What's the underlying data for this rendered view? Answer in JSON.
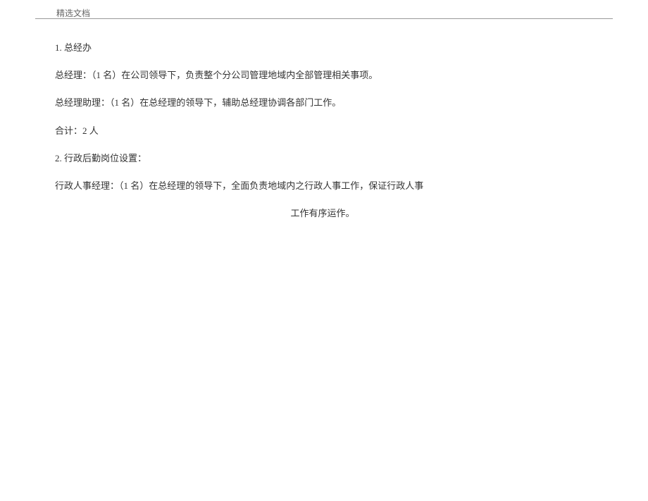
{
  "header": {
    "title": "精选文档"
  },
  "body": {
    "section1_title": "1. 总经办",
    "gm_line": "总经理：（1 名）在公司领导下，负责整个分公司管理地域内全部管理相关事项。",
    "gm_assistant_line": "总经理助理：（1 名）在总经理的领导下，辅助总经理协调各部门工作。",
    "total1": "合计：2 人",
    "section2_title": "2. 行政后勤岗位设置：",
    "hr_manager_line": "行政人事经理：（1 名）在总经理的领导下，全面负责地域内之行政人事工作，保证行政人事",
    "hr_manager_cont": "工作有序运作。"
  }
}
